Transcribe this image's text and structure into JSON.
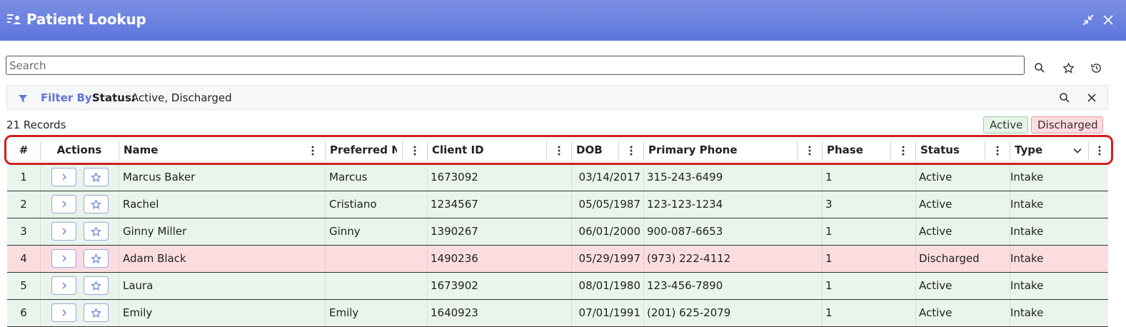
{
  "window": {
    "title": "Patient Lookup",
    "icons": {
      "app": "person-list-icon",
      "collapse": "collapse-icon",
      "close": "close-icon"
    }
  },
  "search": {
    "placeholder": "Search",
    "value": "",
    "icons": {
      "search": "search-icon",
      "favorite": "star-icon",
      "history": "history-icon"
    }
  },
  "filter": {
    "label": "Filter By:",
    "status_key": "Status:",
    "status_value": "Active, Discharged",
    "icons": {
      "funnel": "filter-icon",
      "search": "search-icon",
      "clear": "close-icon"
    }
  },
  "records_count": "21 Records",
  "legend": {
    "active": "Active",
    "discharged": "Discharged"
  },
  "colors": {
    "accent": "#5f74d8",
    "active_row": "#e9f4ea",
    "discharged_row": "#fbdde0",
    "highlight": "#d01f1f"
  },
  "columns": {
    "index": "#",
    "actions": "Actions",
    "name": "Name",
    "preferred": "Preferred Nar",
    "client_id": "Client ID",
    "dob": "DOB",
    "phone": "Primary Phone",
    "phase": "Phase",
    "status": "Status",
    "type": "Type"
  },
  "rows": [
    {
      "index": "1",
      "name": "Marcus Baker",
      "preferred": "Marcus",
      "client_id": "1673092",
      "dob": "03/14/2017",
      "phone": "315-243-6499",
      "phase": "1",
      "status": "Active",
      "type": "Intake"
    },
    {
      "index": "2",
      "name": "Rachel",
      "preferred": "Cristiano",
      "client_id": "1234567",
      "dob": "05/05/1987",
      "phone": "123-123-1234",
      "phase": "3",
      "status": "Active",
      "type": "Intake"
    },
    {
      "index": "3",
      "name": "Ginny Miller",
      "preferred": "Ginny",
      "client_id": "1390267",
      "dob": "06/01/2000",
      "phone": "900-087-6653",
      "phase": "1",
      "status": "Active",
      "type": "Intake"
    },
    {
      "index": "4",
      "name": "Adam Black",
      "preferred": "",
      "client_id": "1490236",
      "dob": "05/29/1997",
      "phone": "(973) 222-4112",
      "phase": "1",
      "status": "Discharged",
      "type": "Intake"
    },
    {
      "index": "5",
      "name": "Laura",
      "preferred": "",
      "client_id": "1673902",
      "dob": "08/01/1980",
      "phone": "123-456-7890",
      "phase": "1",
      "status": "Active",
      "type": "Intake"
    },
    {
      "index": "6",
      "name": "Emily",
      "preferred": "Emily",
      "client_id": "1640923",
      "dob": "07/01/1991",
      "phone": "(201) 625-2079",
      "phase": "1",
      "status": "Active",
      "type": "Intake"
    }
  ]
}
